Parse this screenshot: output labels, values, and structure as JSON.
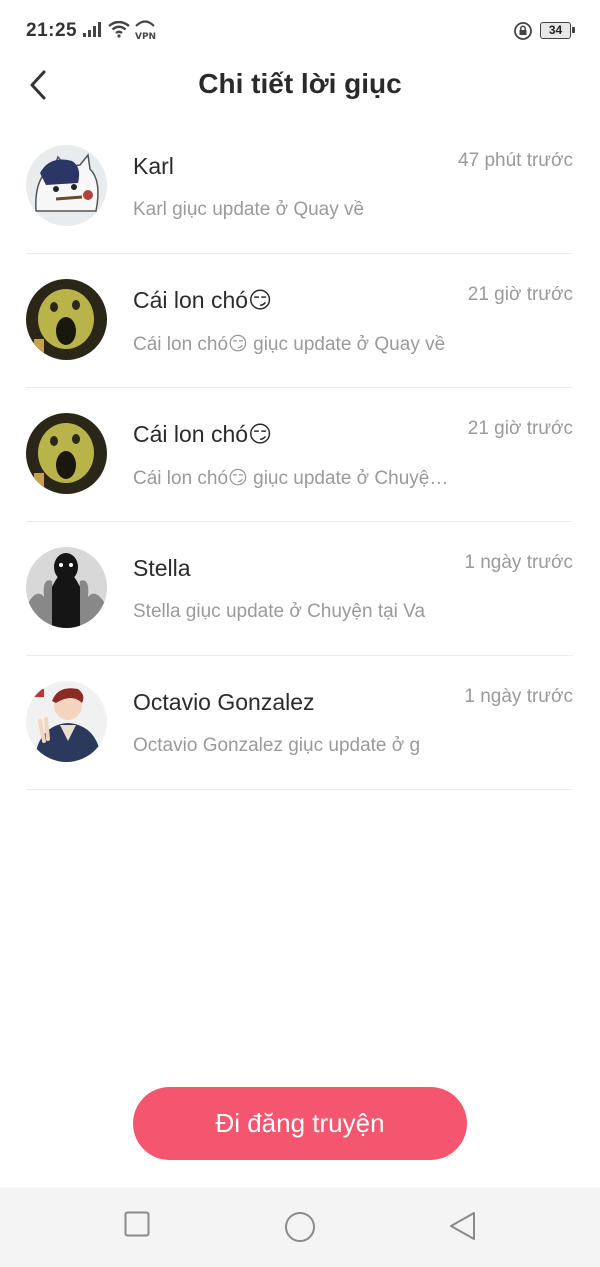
{
  "status_bar": {
    "time": "21:25",
    "battery": "34"
  },
  "header": {
    "title": "Chi tiết lời giục"
  },
  "items": [
    {
      "name": "Karl",
      "time": "47 phút trước",
      "message": "Karl giục update ở Quay về",
      "avatar_icon": "cartoon-cat-avatar"
    },
    {
      "name": "Cái lon chó😏",
      "time": "21 giờ trước",
      "message": "Cái lon chó😏 giục update ở Quay về",
      "avatar_icon": "screaming-dog-avatar"
    },
    {
      "name": "Cái lon chó😏",
      "time": "21 giờ trước",
      "message": "Cái lon chó😏 giục update ở Chuyện tại Va",
      "avatar_icon": "screaming-dog-avatar"
    },
    {
      "name": "Stella",
      "time": "1 ngày trước",
      "message": "Stella giục update ở Chuyện tại Va",
      "avatar_icon": "dark-figure-avatar"
    },
    {
      "name": "Octavio Gonzalez",
      "time": "1 ngày trước",
      "message": "Octavio Gonzalez giục update ở g",
      "avatar_icon": "anime-boy-avatar"
    }
  ],
  "post_button": {
    "label": "Đi đăng truyện"
  },
  "colors": {
    "accent": "#f5566f",
    "muted_text": "#9a9a9a"
  }
}
